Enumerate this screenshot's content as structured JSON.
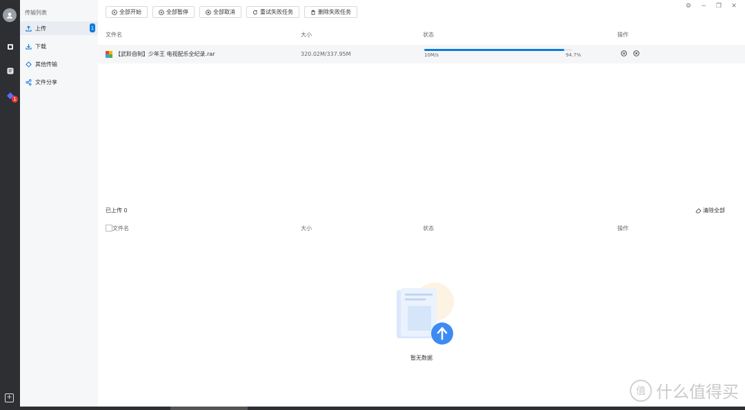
{
  "sidebar": {
    "title": "传输列表",
    "items": [
      {
        "label": "上传",
        "icon": "upload-icon",
        "badge": "1",
        "active": true
      },
      {
        "label": "下载",
        "icon": "download-icon"
      },
      {
        "label": "其他传输",
        "icon": "diamond-icon"
      },
      {
        "label": "文件分享",
        "icon": "share-icon"
      }
    ],
    "rail_badge": "1"
  },
  "toolbar": {
    "start_all": "全部开始",
    "pause_all": "全部暂停",
    "cancel_all": "全部取消",
    "retry_failed": "重试失败任务",
    "delete_failed": "删除失败任务"
  },
  "table": {
    "headers": {
      "name": "文件名",
      "size": "大小",
      "status": "状态",
      "action": "操作"
    },
    "rows": [
      {
        "name": "【武聆自制】少年王 电视配乐全纪录.rar",
        "size": "320.02M/337.95M",
        "speed": "10M/s",
        "percent": "94.7%",
        "progress": 0.947
      }
    ]
  },
  "uploaded": {
    "title": "已上传 0",
    "clear_all": "清除全部",
    "headers": {
      "name": "文件名",
      "size": "大小",
      "status": "状态",
      "action": "操作"
    },
    "empty_text": "暂无数据"
  },
  "watermark": {
    "text": "什么值得买",
    "mark": "值"
  },
  "colors": {
    "accent": "#0b7bdb",
    "rail": "#2d2f33",
    "badge_red": "#e53935"
  }
}
